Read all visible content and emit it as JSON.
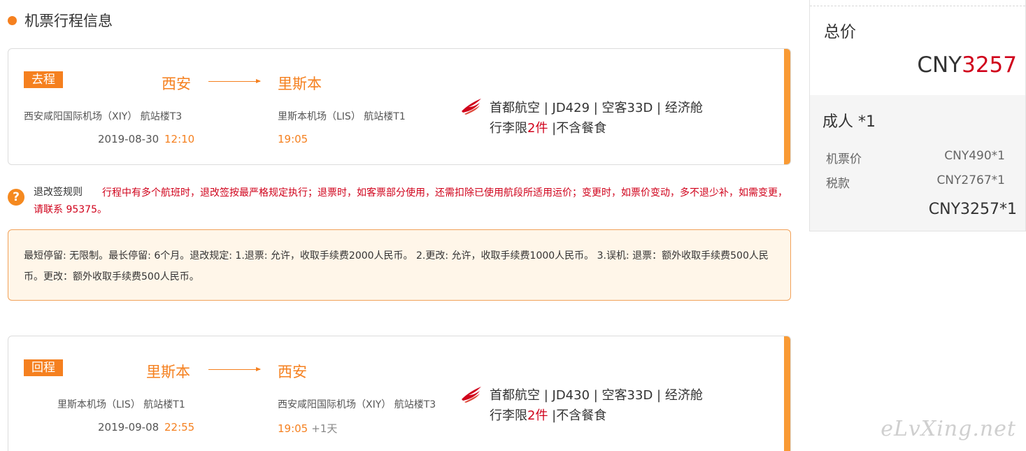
{
  "section_title": "机票行程信息",
  "outbound": {
    "badge": "去程",
    "from_city": "西安",
    "to_city": "里斯本",
    "from_airport": "西安咸阳国际机场（XIY） 航站楼T3",
    "to_airport": "里斯本机场（LIS） 航站楼T1",
    "date": "2019-08-30",
    "depart_time": "12:10",
    "arrive_time": "19:05",
    "arrive_extra": "",
    "flight_line": "首都航空 | JD429 | 空客33D | 经济舱",
    "baggage_prefix": "行李限",
    "baggage_count": "2件",
    "baggage_suffix": " |不含餐食"
  },
  "return": {
    "badge": "回程",
    "from_city": "里斯本",
    "to_city": "西安",
    "from_airport": "里斯本机场（LIS） 航站楼T1",
    "to_airport": "西安咸阳国际机场（XIY） 航站楼T3",
    "date": "2019-09-08",
    "depart_time": "22:55",
    "arrive_time": "19:05",
    "arrive_extra": "+1天",
    "flight_line": "首都航空 | JD430 | 空客33D | 经济舱",
    "baggage_prefix": "行李限",
    "baggage_count": "2件",
    "baggage_suffix": " |不含餐食"
  },
  "rules": {
    "label": "退改签规则",
    "text": "行程中有多个航班时，退改签按最严格规定执行；退票时，如客票部分使用，还需扣除已使用航段所适用运价；变更时，如票价变动，多不退少补，如需变更，请联系 95375。"
  },
  "policy": {
    "text": "最短停留: 无限制。最长停留: 6个月。退改规定: 1.退票: 允许，收取手续费2000人民币。 2.更改: 允许，收取手续费1000人民币。 3.误机: 退票：额外收取手续费500人民币。更改：额外收取手续费500人民币。"
  },
  "summary": {
    "label": "总价",
    "currency": "CNY",
    "total": "3257",
    "adult_label": "成人 *1",
    "ticket_label": "机票价",
    "ticket_value": "CNY490*1",
    "tax_label": "税款",
    "tax_value": "CNY2767*1",
    "subtotal": "CNY3257*1"
  },
  "watermark": "eLvXing.net",
  "colors": {
    "accent": "#f5801f",
    "red": "#d0021b",
    "policy_bg": "#fff6e9"
  },
  "icons": {
    "airline": "capital-airlines-logo",
    "help": "question-icon"
  }
}
